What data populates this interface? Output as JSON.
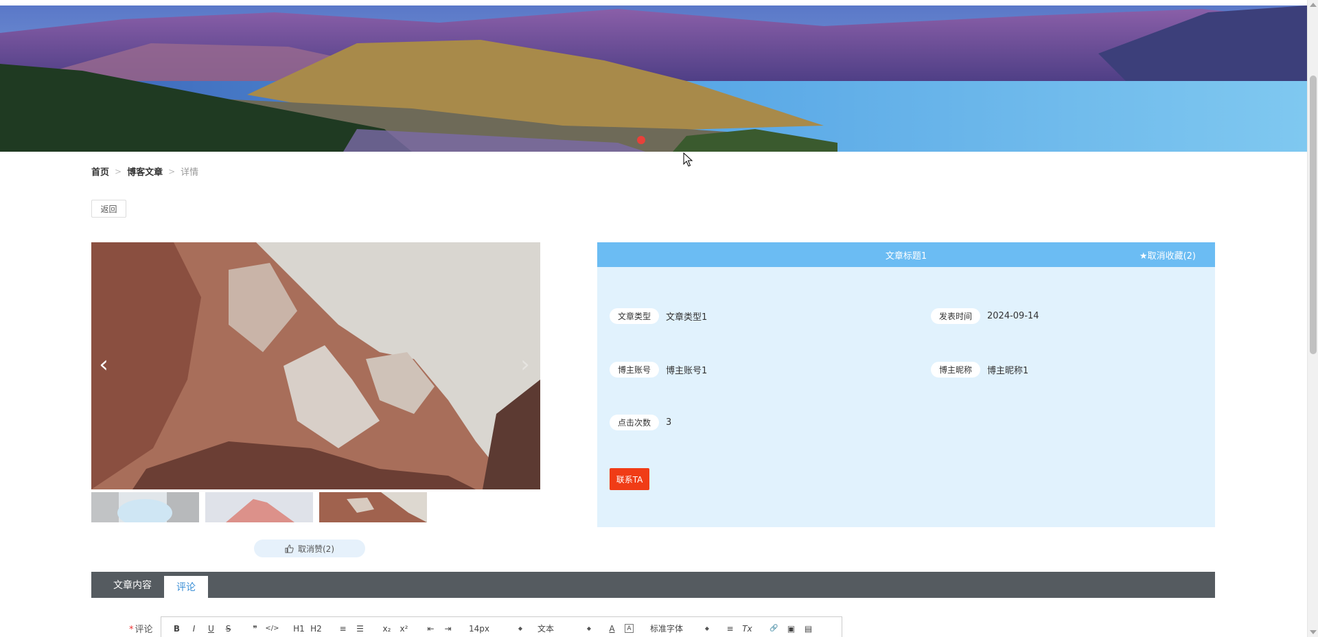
{
  "breadcrumb": {
    "home": "首页",
    "list": "博客文章",
    "current": "详情",
    "separator": ">"
  },
  "back_button": "返回",
  "carousel": {
    "prev_icon": "chevron-left-icon",
    "next_icon": "chevron-right-icon",
    "prev_glyph": "‹",
    "next_glyph": "›"
  },
  "like_button": {
    "icon": "thumbs-up-icon",
    "label": "取消赞(2)"
  },
  "article": {
    "title": "文章标题1",
    "favorite_label": "★取消收藏(2)",
    "fields": {
      "type_label": "文章类型",
      "type_value": "文章类型1",
      "time_label": "发表时间",
      "time_value": "2024-09-14",
      "account_label": "博主账号",
      "account_value": "博主账号1",
      "nickname_label": "博主昵称",
      "nickname_value": "博主昵称1",
      "clicks_label": "点击次数",
      "clicks_value": "3"
    },
    "contact_button": "联系TA"
  },
  "tabs": [
    {
      "label": "文章内容"
    },
    {
      "label": "评论"
    }
  ],
  "comment": {
    "required_mark": "*",
    "label": "评论"
  },
  "editor_toolbar": {
    "bold": "B",
    "italic": "I",
    "underline": "U",
    "strike": "S",
    "blockquote": "❞",
    "code": "</>",
    "h1": "H1",
    "h2": "H2",
    "ordered_list": "≡",
    "bullet_list": "☰",
    "subscript": "x₂",
    "superscript": "x²",
    "outdent": "⇤",
    "indent": "⇥",
    "size_value": "14px",
    "block_value": "文本",
    "font_value": "标准字体",
    "color": "A",
    "background": "A",
    "align": "≡",
    "clean": "Tx",
    "link": "🔗",
    "image": "▣",
    "video": "▤"
  },
  "colors": {
    "header_blue": "#6bbcf3",
    "panel_bg": "#e1f2fd",
    "contact_red": "#f03c16",
    "tab_bar": "#555b60",
    "active_tab_text": "#3b8fd6"
  }
}
